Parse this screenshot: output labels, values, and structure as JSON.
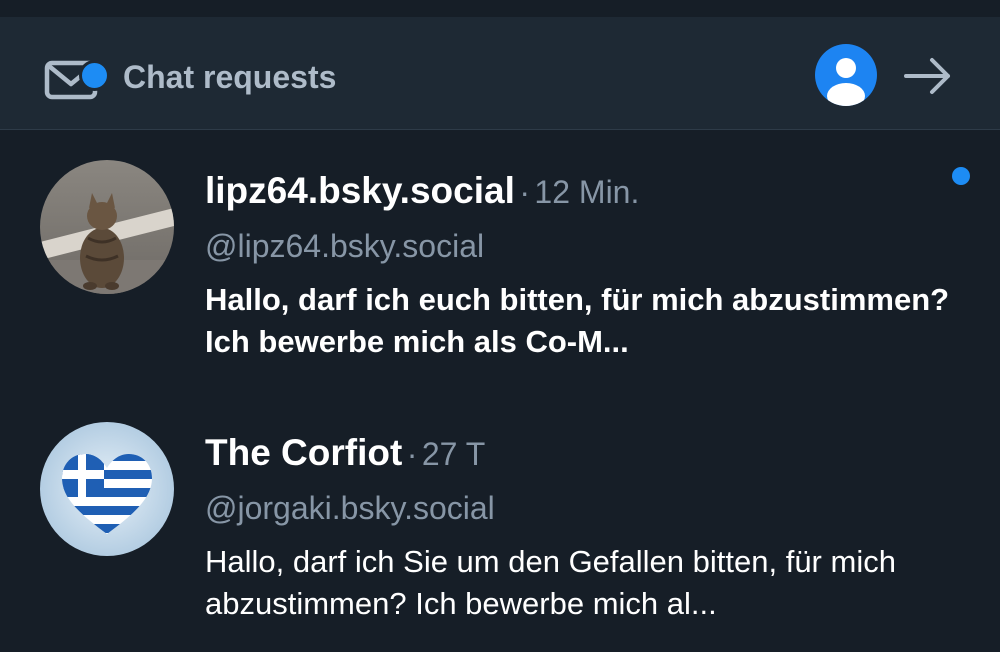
{
  "header": {
    "title": "Chat requests"
  },
  "conversations": [
    {
      "name": "lipz64.bsky.social",
      "separator": "·",
      "time": "12 Min.",
      "handle": "@lipz64.bsky.social",
      "message": "Hallo, darf ich euch bitten, für mich abzustimmen? Ich bewerbe mich als Co-M...",
      "unread": true
    },
    {
      "name": "The Corfiot",
      "separator": "·",
      "time": "27 T",
      "handle": "@jorgaki.bsky.social",
      "message": "Hallo, darf ich Sie um den Gefallen bitten, für mich abzustimmen? Ich bewerbe mich al...",
      "unread": false
    }
  ],
  "colors": {
    "background": "#161e27",
    "header_background": "#1e2934",
    "accent": "#1d8cf4",
    "muted_text": "#8796a6"
  }
}
